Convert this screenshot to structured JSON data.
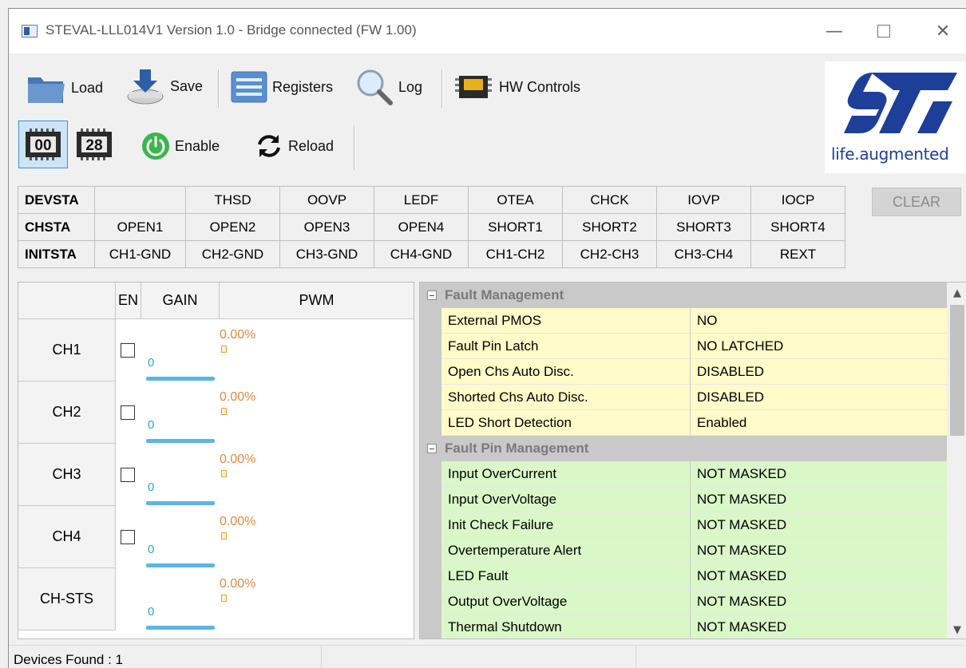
{
  "window": {
    "title": "STEVAL-LLL014V1 Version 1.0 - Bridge connected (FW 1.00)",
    "controls": {
      "minimize": "—",
      "close": "✕"
    }
  },
  "toolbar": {
    "load": "Load",
    "save": "Save",
    "registers": "Registers",
    "log": "Log",
    "hw_controls": "HW Controls",
    "device_00": "00",
    "device_28": "28",
    "enable": "Enable",
    "reload": "Reload"
  },
  "logo": {
    "tagline": "life.augmented"
  },
  "status_grid": {
    "rows": [
      {
        "name": "DEVSTA",
        "cells": [
          "",
          "THSD",
          "OOVP",
          "LEDF",
          "OTEA",
          "CHCK",
          "IOVP",
          "IOCP"
        ]
      },
      {
        "name": "CHSTA",
        "cells": [
          "OPEN1",
          "OPEN2",
          "OPEN3",
          "OPEN4",
          "SHORT1",
          "SHORT2",
          "SHORT3",
          "SHORT4"
        ]
      },
      {
        "name": "INITSTA",
        "cells": [
          "CH1-GND",
          "CH2-GND",
          "CH3-GND",
          "CH4-GND",
          "CH1-CH2",
          "CH2-CH3",
          "CH3-CH4",
          "REXT"
        ]
      }
    ],
    "clear_label": "CLEAR"
  },
  "channels": {
    "headers": {
      "en": "EN",
      "gain": "GAIN",
      "pwm": "PWM"
    },
    "rows": [
      {
        "label": "CH1",
        "has_en": true,
        "gain": "0",
        "pwm": "0.00%"
      },
      {
        "label": "CH2",
        "has_en": true,
        "gain": "0",
        "pwm": "0.00%"
      },
      {
        "label": "CH3",
        "has_en": true,
        "gain": "0",
        "pwm": "0.00%"
      },
      {
        "label": "CH4",
        "has_en": true,
        "gain": "0",
        "pwm": "0.00%"
      },
      {
        "label": "CH-STS",
        "has_en": false,
        "gain": "0",
        "pwm": "0.00%"
      }
    ]
  },
  "properties": {
    "groups": [
      {
        "name": "Fault Management",
        "color": "#fffbc8",
        "items": [
          {
            "name": "External PMOS",
            "value": "NO"
          },
          {
            "name": "Fault Pin Latch",
            "value": "NO LATCHED"
          },
          {
            "name": "Open Chs Auto Disc.",
            "value": "DISABLED"
          },
          {
            "name": "Shorted Chs Auto Disc.",
            "value": "DISABLED"
          },
          {
            "name": "LED Short Detection",
            "value": "Enabled"
          }
        ]
      },
      {
        "name": "Fault Pin Management",
        "color": "#daf7c8",
        "items": [
          {
            "name": "Input OverCurrent",
            "value": "NOT MASKED"
          },
          {
            "name": "Input OverVoltage",
            "value": "NOT MASKED"
          },
          {
            "name": "Init Check Failure",
            "value": "NOT MASKED"
          },
          {
            "name": "Overtemperature Alert",
            "value": "NOT MASKED"
          },
          {
            "name": "LED Fault",
            "value": "NOT MASKED"
          },
          {
            "name": "Output OverVoltage",
            "value": "NOT MASKED"
          },
          {
            "name": "Thermal Shutdown",
            "value": "NOT MASKED"
          }
        ]
      }
    ]
  },
  "statusbar": {
    "text": "Devices Found : 1"
  }
}
